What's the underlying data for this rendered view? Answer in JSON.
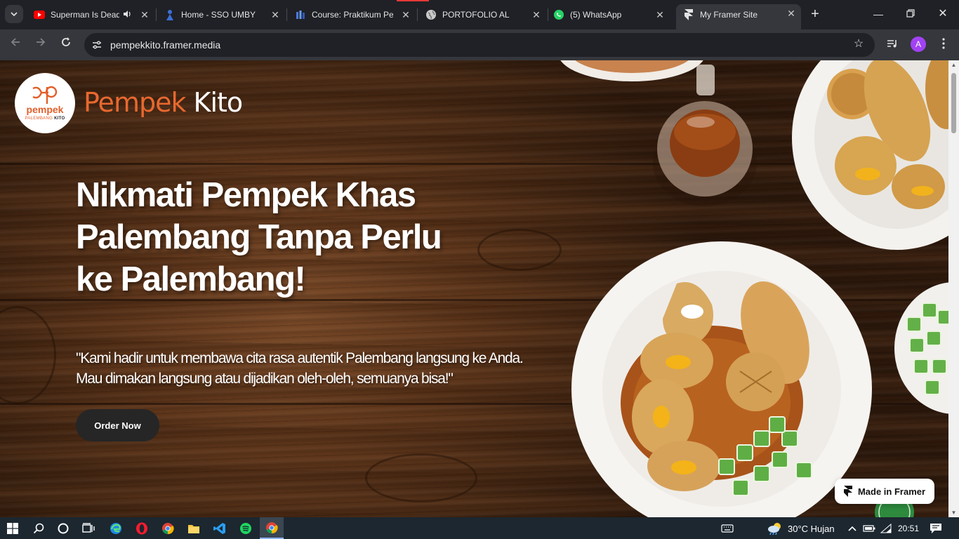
{
  "browser": {
    "tabs": [
      {
        "title": "Superman Is Dead",
        "favicon": "youtube-icon",
        "audio": true
      },
      {
        "title": "Home - SSO UMBY",
        "favicon": "umby-icon"
      },
      {
        "title": "Course: Praktikum Pen",
        "favicon": "moodle-icon"
      },
      {
        "title": "PORTOFOLIO AL",
        "favicon": "globe-icon"
      },
      {
        "title": "(5) WhatsApp",
        "favicon": "whatsapp-icon"
      },
      {
        "title": "My Framer Site",
        "favicon": "framer-icon",
        "active": true
      }
    ],
    "url": "pempekkito.framer.media",
    "profile_initial": "A"
  },
  "page": {
    "logo": {
      "word": "pempek",
      "sub_a": "PALEMBANG ",
      "sub_b": "KITO"
    },
    "brand": {
      "part1": "Pempek",
      "part2": " Kito"
    },
    "hero": {
      "title_line1": "Nikmati Pempek Khas",
      "title_line2": "Palembang Tanpa Perlu",
      "title_line3": "ke Palembang!",
      "description": "\"Kami hadir untuk membawa cita rasa autentik Palembang langsung ke Anda. Mau dimakan langsung atau dijadikan oleh-oleh, semuanya bisa!\"",
      "cta": "Order Now"
    },
    "badge": "Made in Framer"
  },
  "taskbar": {
    "weather": "30°C  Hujan",
    "time": "20:51"
  },
  "colors": {
    "brand_orange": "#e8682f",
    "button_dark": "#262626",
    "chrome_dark": "#1f2126",
    "chrome_toolbar": "#35373c"
  }
}
